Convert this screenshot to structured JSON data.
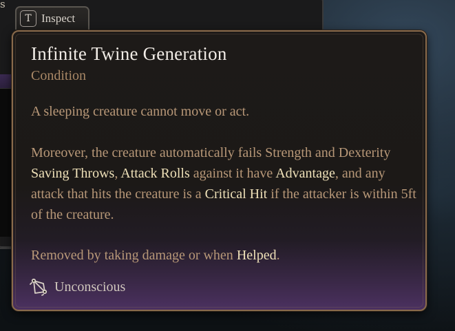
{
  "background": {
    "corner_text": "s"
  },
  "inspect_tab": {
    "key": "T",
    "label": "Inspect"
  },
  "tooltip": {
    "title": "Infinite Twine Generation",
    "subtitle": "Condition",
    "paragraph_1": "A sleeping creature cannot move or act.",
    "paragraph_2": {
      "t1": "Moreover, the creature automatically fails Strength and Dexterity ",
      "k1": "Saving Throws",
      "t2": ", ",
      "k2": "Attack Rolls",
      "t3": " against it have ",
      "k3": "Advantage",
      "t4": ", and any attack that hits the creature is a ",
      "k4": "Critical Hit",
      "t5": " if the attacker is within 5ft of the creature."
    },
    "paragraph_3": {
      "t1": "Removed by taking damage or when ",
      "k1": "Helped",
      "t2": "."
    },
    "footer": {
      "icon": "unconscious-condition-icon",
      "label": "Unconscious"
    }
  },
  "colors": {
    "border": "#8a6b4c",
    "title": "#f1ece6",
    "subtitle": "#a98866",
    "body_text": "#b89878",
    "keyword": "#eee0b8",
    "purple_glow": "#4b3160"
  }
}
